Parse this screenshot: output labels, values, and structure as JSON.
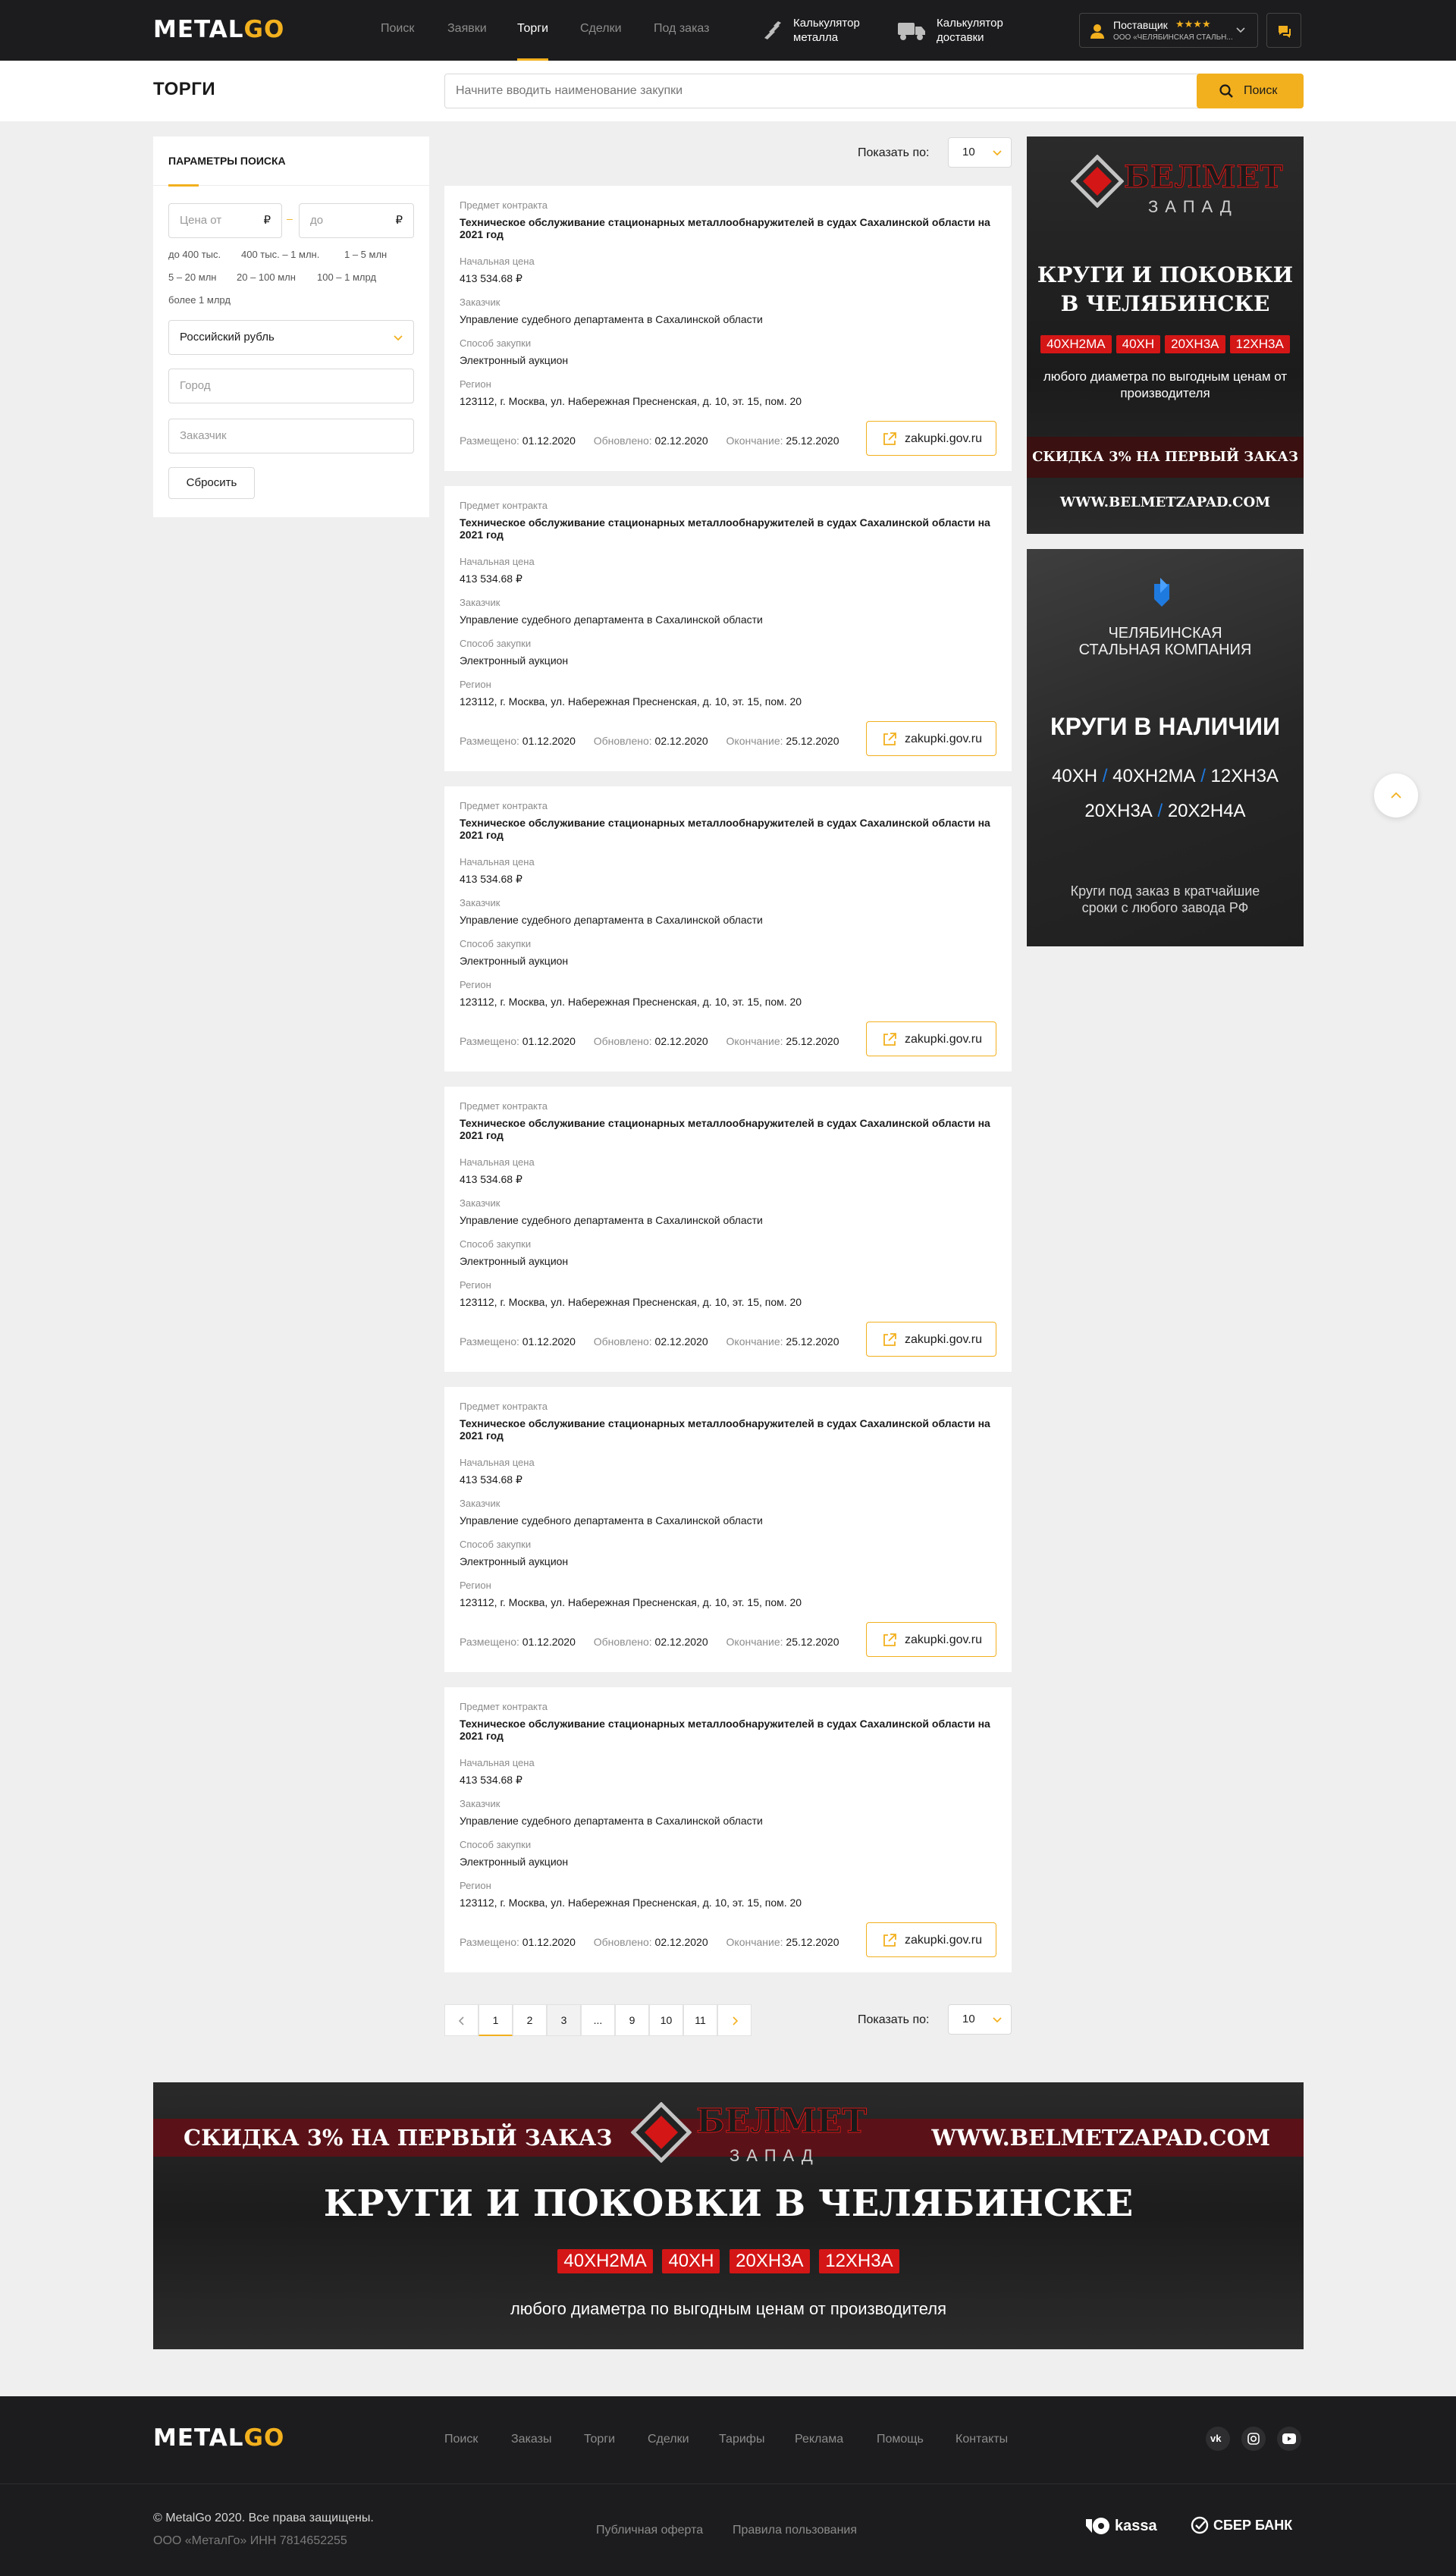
{
  "header": {
    "logo_metal": "METAL",
    "logo_go": "GO",
    "nav": [
      "Поиск",
      "Заявки",
      "Торги",
      "Сделки",
      "Под заказ"
    ],
    "calc_metal": "Калькулятор металла",
    "calc_delivery": "Калькулятор доставки",
    "user_role": "Поставщик",
    "user_stars": "★★★★",
    "user_org": "ООО «ЧЕЛЯБИНСКАЯ СТАЛЬН..."
  },
  "page": {
    "title": "ТОРГИ",
    "search_placeholder": "Начните вводить наименование закупки",
    "search_button": "Поиск"
  },
  "filters": {
    "title": "ПАРАМЕТРЫ ПОИСКА",
    "price_from": "Цена от",
    "price_to": "до",
    "currency_sign": "₽",
    "price_ranges": [
      "до 400 тыс.",
      "400 тыс. – 1 млн.",
      "1 – 5 млн",
      "5 – 20 млн",
      "20 – 100 млн",
      "100 – 1 млрд",
      "более 1 млрд"
    ],
    "currency": "Российский рубль",
    "city_placeholder": "Город",
    "customer_placeholder": "Заказчик",
    "reset": "Сбросить"
  },
  "list": {
    "show_by_label": "Показать по:",
    "show_by_value": "10",
    "labels": {
      "subject": "Предмет контракта",
      "price": "Начальная цена",
      "customer": "Заказчик",
      "method": "Способ закупки",
      "region": "Регион",
      "posted": "Размещено:",
      "updated": "Обновлено:",
      "ends": "Окончание:"
    },
    "items": [
      {
        "subject": "Техническое обслуживание стационарных металлообнаружителей в судах Сахалинской области на 2021 год",
        "price": "413 534.68 ₽",
        "customer": "Управление судебного департамента в Сахалинской области",
        "method": "Электронный аукцион",
        "region": "123112, г. Москва, ул. Набережная Пресненская, д. 10, эт. 15, пом. 20",
        "posted": "01.12.2020",
        "updated": "02.12.2020",
        "ends": "25.12.2020",
        "link": "zakupki.gov.ru"
      },
      {
        "subject": "Техническое обслуживание стационарных металлообнаружителей в судах Сахалинской области на 2021 год",
        "price": "413 534.68 ₽",
        "customer": "Управление судебного департамента в Сахалинской области",
        "method": "Электронный аукцион",
        "region": "123112, г. Москва, ул. Набережная Пресненская, д. 10, эт. 15, пом. 20",
        "posted": "01.12.2020",
        "updated": "02.12.2020",
        "ends": "25.12.2020",
        "link": "zakupki.gov.ru"
      },
      {
        "subject": "Техническое обслуживание стационарных металлообнаружителей в судах Сахалинской области на 2021 год",
        "price": "413 534.68 ₽",
        "customer": "Управление судебного департамента в Сахалинской области",
        "method": "Электронный аукцион",
        "region": "123112, г. Москва, ул. Набережная Пресненская, д. 10, эт. 15, пом. 20",
        "posted": "01.12.2020",
        "updated": "02.12.2020",
        "ends": "25.12.2020",
        "link": "zakupki.gov.ru"
      },
      {
        "subject": "Техническое обслуживание стационарных металлообнаружителей в судах Сахалинской области на 2021 год",
        "price": "413 534.68 ₽",
        "customer": "Управление судебного департамента в Сахалинской области",
        "method": "Электронный аукцион",
        "region": "123112, г. Москва, ул. Набережная Пресненская, д. 10, эт. 15, пом. 20",
        "posted": "01.12.2020",
        "updated": "02.12.2020",
        "ends": "25.12.2020",
        "link": "zakupki.gov.ru"
      },
      {
        "subject": "Техническое обслуживание стационарных металлообнаружителей в судах Сахалинской области на 2021 год",
        "price": "413 534.68 ₽",
        "customer": "Управление судебного департамента в Сахалинской области",
        "method": "Электронный аукцион",
        "region": "123112, г. Москва, ул. Набережная Пресненская, д. 10, эт. 15, пом. 20",
        "posted": "01.12.2020",
        "updated": "02.12.2020",
        "ends": "25.12.2020",
        "link": "zakupki.gov.ru"
      },
      {
        "subject": "Техническое обслуживание стационарных металлообнаружителей в судах Сахалинской области на 2021 год",
        "price": "413 534.68 ₽",
        "customer": "Управление судебного департамента в Сахалинской области",
        "method": "Электронный аукцион",
        "region": "123112, г. Москва, ул. Набережная Пресненская, д. 10, эт. 15, пом. 20",
        "posted": "01.12.2020",
        "updated": "02.12.2020",
        "ends": "25.12.2020",
        "link": "zakupki.gov.ru"
      }
    ]
  },
  "pagination": {
    "pages": [
      "1",
      "2",
      "3",
      "...",
      "9",
      "10",
      "11"
    ],
    "current": "1"
  },
  "ads": {
    "belmet_brand": "БЕЛМЕТ",
    "belmet_sub": "ЗАПАД",
    "belmet_headline_1": "КРУГИ И ПОКОВКИ",
    "belmet_headline_2": "В ЧЕЛЯБИНСКЕ",
    "belmet_headline_wide": "КРУГИ И ПОКОВКИ В ЧЕЛЯБИНСКЕ",
    "belmet_tags": [
      "40ХН2МА",
      "40ХН",
      "20ХН3А",
      "12ХН3А"
    ],
    "belmet_desc": "любого диаметра по выгодным ценам от производителя",
    "belmet_discount": "СКИДКА 3% НА ПЕРВЫЙ ЗАКАЗ",
    "belmet_site": "WWW.BELMETZAPAD.COM",
    "chsk_name": "ЧЕЛЯБИНСКАЯ СТАЛЬНАЯ КОМПАНИЯ",
    "chsk_headline": "КРУГИ В НАЛИЧИИ",
    "chsk_grades_1": [
      "40ХН",
      "40ХН2МА",
      "12ХН3А"
    ],
    "chsk_grades_2": [
      "20ХН3А",
      "20Х2Н4А"
    ],
    "chsk_desc": "Круги под заказ в кратчайшие сроки с любого завода РФ"
  },
  "footer": {
    "nav": [
      "Поиск",
      "Заказы",
      "Торги",
      "Сделки",
      "Тарифы",
      "Реклама",
      "Помощь",
      "Контакты"
    ],
    "copyright": "© MetalGo 2020. Все права защищены.",
    "company": "ООО «МеталГо» ИНН 7814652255",
    "offer": "Публичная оферта",
    "terms": "Правила пользования",
    "pay_kassa": "kassa",
    "pay_sber": "СБЕР БАНК"
  },
  "colors": {
    "accent": "#f2b01e",
    "dark": "#1c1c1e",
    "ad_red": "#d41616",
    "ad_blue": "#1f7ae0"
  }
}
